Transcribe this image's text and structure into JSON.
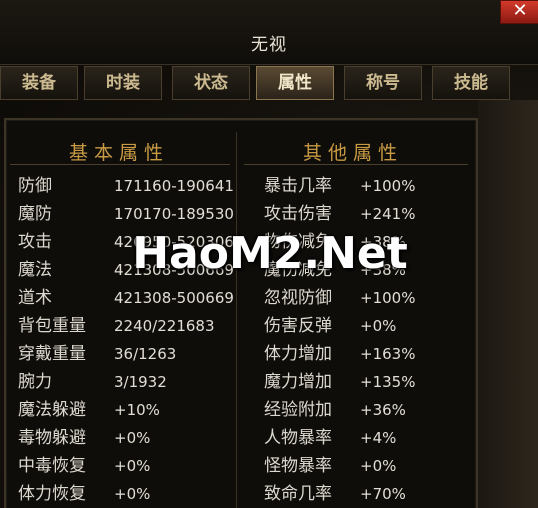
{
  "window": {
    "title": "无视",
    "close_label": "✕"
  },
  "tabs": [
    {
      "label": "装备",
      "active": false
    },
    {
      "label": "时装",
      "active": false
    },
    {
      "label": "状态",
      "active": false
    },
    {
      "label": "属性",
      "active": true
    },
    {
      "label": "称号",
      "active": false
    },
    {
      "label": "技能",
      "active": false
    }
  ],
  "left_header": "基本属性",
  "right_header": "其他属性",
  "left_rows": [
    {
      "label": "防御",
      "value": "171160-190641"
    },
    {
      "label": "魔防",
      "value": "170170-189530"
    },
    {
      "label": "攻击",
      "value": "426950-520306"
    },
    {
      "label": "魔法",
      "value": "421308-500669"
    },
    {
      "label": "道术",
      "value": "421308-500669"
    },
    {
      "label": "背包重量",
      "value": "2240/221683"
    },
    {
      "label": "穿戴重量",
      "value": "36/1263"
    },
    {
      "label": "腕力",
      "value": "3/1932"
    },
    {
      "label": "魔法躲避",
      "value": "+10%"
    },
    {
      "label": "毒物躲避",
      "value": "+0%"
    },
    {
      "label": "中毒恢复",
      "value": "+0%"
    },
    {
      "label": "体力恢复",
      "value": "+0%"
    }
  ],
  "right_rows": [
    {
      "label": "暴击几率",
      "value": "+100%"
    },
    {
      "label": "攻击伤害",
      "value": "+241%"
    },
    {
      "label": "物伤减免",
      "value": "+38%"
    },
    {
      "label": "魔伤减免",
      "value": "+38%"
    },
    {
      "label": "忽视防御",
      "value": "+100%"
    },
    {
      "label": "伤害反弹",
      "value": "+0%"
    },
    {
      "label": "体力增加",
      "value": "+163%"
    },
    {
      "label": "魔力增加",
      "value": "+135%"
    },
    {
      "label": "经验附加",
      "value": "+36%"
    },
    {
      "label": "人物暴率",
      "value": "+4%"
    },
    {
      "label": "怪物暴率",
      "value": "+0%"
    },
    {
      "label": "致命几率",
      "value": "+70%"
    }
  ],
  "watermark": "HaoM2.Net"
}
